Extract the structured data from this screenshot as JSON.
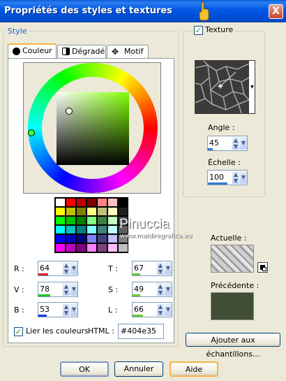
{
  "window": {
    "title": "Propriétés des styles et textures",
    "close_glyph": "X"
  },
  "style_group": {
    "label": "Style"
  },
  "tabs": [
    {
      "label": "Couleur",
      "active": true,
      "icon": "circle-icon"
    },
    {
      "label": "Dégradé",
      "active": false,
      "icon": "gradient-icon"
    },
    {
      "label": "Motif",
      "active": false,
      "icon": "pattern-icon"
    }
  ],
  "color": {
    "current_hex": "#404e35",
    "channels": [
      {
        "label": "R :",
        "value": "64",
        "level": 0.25,
        "color": "#e0211e"
      },
      {
        "label": "V :",
        "value": "78",
        "level": 0.31,
        "color": "#1fc51f"
      },
      {
        "label": "B :",
        "value": "53",
        "level": 0.21,
        "color": "#1e3be0"
      },
      {
        "label": "T :",
        "value": "67",
        "level": 0.19,
        "color": "#66cc33"
      },
      {
        "label": "S :",
        "value": "49",
        "level": 0.19,
        "color": "#66cc33"
      },
      {
        "label": "L :",
        "value": "66",
        "level": 0.26,
        "color": "#66cc33"
      }
    ],
    "html_label": "HTML :",
    "html_value": "#404e35",
    "link_colors": {
      "label": "Lier les couleurs",
      "checked": true
    }
  },
  "watermark": {
    "line1": "Pinuccia",
    "line2": "www.maidiregrafica.eu"
  },
  "texture": {
    "label": "Texture",
    "checked": true,
    "angle_label": "Angle :",
    "angle_value": "45",
    "angle_level": 0.12,
    "scale_label": "Échelle :",
    "scale_value": "100",
    "scale_level": 0.5
  },
  "preview": {
    "current_label": "Actuelle :",
    "previous_label": "Précédente :",
    "previous_color": "#404e35"
  },
  "buttons": {
    "add_swatches": "Ajouter aux échantillons...",
    "ok": "OK",
    "cancel": "Annuler",
    "help": "Aide"
  },
  "palette_rows": [
    [
      "#ffffff",
      "#ff0000",
      "#c00000",
      "#800000",
      "#ff8080",
      "#ffc0c0",
      "#000000"
    ],
    [
      "#ffff00",
      "#c0c000",
      "#808000",
      "#ffff80",
      "#c0c080",
      "#ffffc0",
      "#202020"
    ],
    [
      "#00ff00",
      "#00c000",
      "#008000",
      "#80ff80",
      "#408040",
      "#c0ffc0",
      "#404040"
    ],
    [
      "#00ffff",
      "#00c0c0",
      "#008080",
      "#80ffff",
      "#408080",
      "#c0ffff",
      "#606060"
    ],
    [
      "#0000ff",
      "#0000c0",
      "#000080",
      "#8080ff",
      "#404080",
      "#c0c0ff",
      "#808080"
    ],
    [
      "#ff00ff",
      "#c000c0",
      "#800080",
      "#ff80ff",
      "#804080",
      "#ffc0ff",
      "#c0c0c0"
    ]
  ]
}
